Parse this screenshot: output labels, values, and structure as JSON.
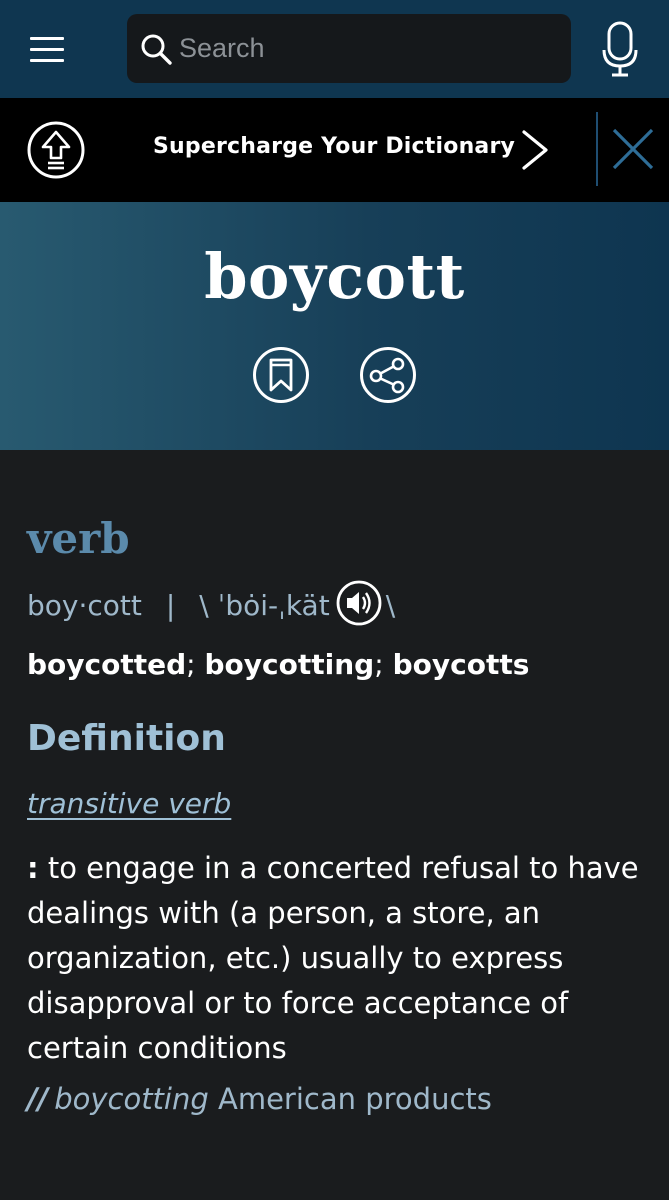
{
  "header": {
    "search_placeholder": "Search",
    "icons": [
      "menu-icon",
      "search-icon",
      "microphone-icon"
    ]
  },
  "promo": {
    "text": "Supercharge Your Dictionary",
    "icons": [
      "upgrade-arrow-icon",
      "chevron-right-icon",
      "close-icon"
    ]
  },
  "entry": {
    "word": "boycott",
    "icons": [
      "bookmark-icon",
      "share-icon"
    ],
    "part_of_speech": "verb",
    "syllables": "boy·cott",
    "separator": "|",
    "pron_open": "\\",
    "pronunciation": "ˈbȯi-ˌkät",
    "pron_close": "\\",
    "forms": [
      "boycotted",
      "boycotting",
      "boycotts"
    ],
    "form_separator": ";",
    "definition_heading": "Definition",
    "sub_pos": "transitive verb",
    "definition_colon": ":",
    "definition": "to engage in a concerted refusal to have dealings with (a person, a store, an organization, etc.) usually to express disapproval or to force acceptance of certain conditions",
    "example_marker": "//",
    "example_italic": "boycotting",
    "example_rest": "American products"
  },
  "colors": {
    "header_bg": "#0f3650",
    "promo_bg": "#000000",
    "page_bg": "#1a1c1e",
    "accent_blue": "#5b8aab",
    "light_blue": "#9fc0d6"
  }
}
